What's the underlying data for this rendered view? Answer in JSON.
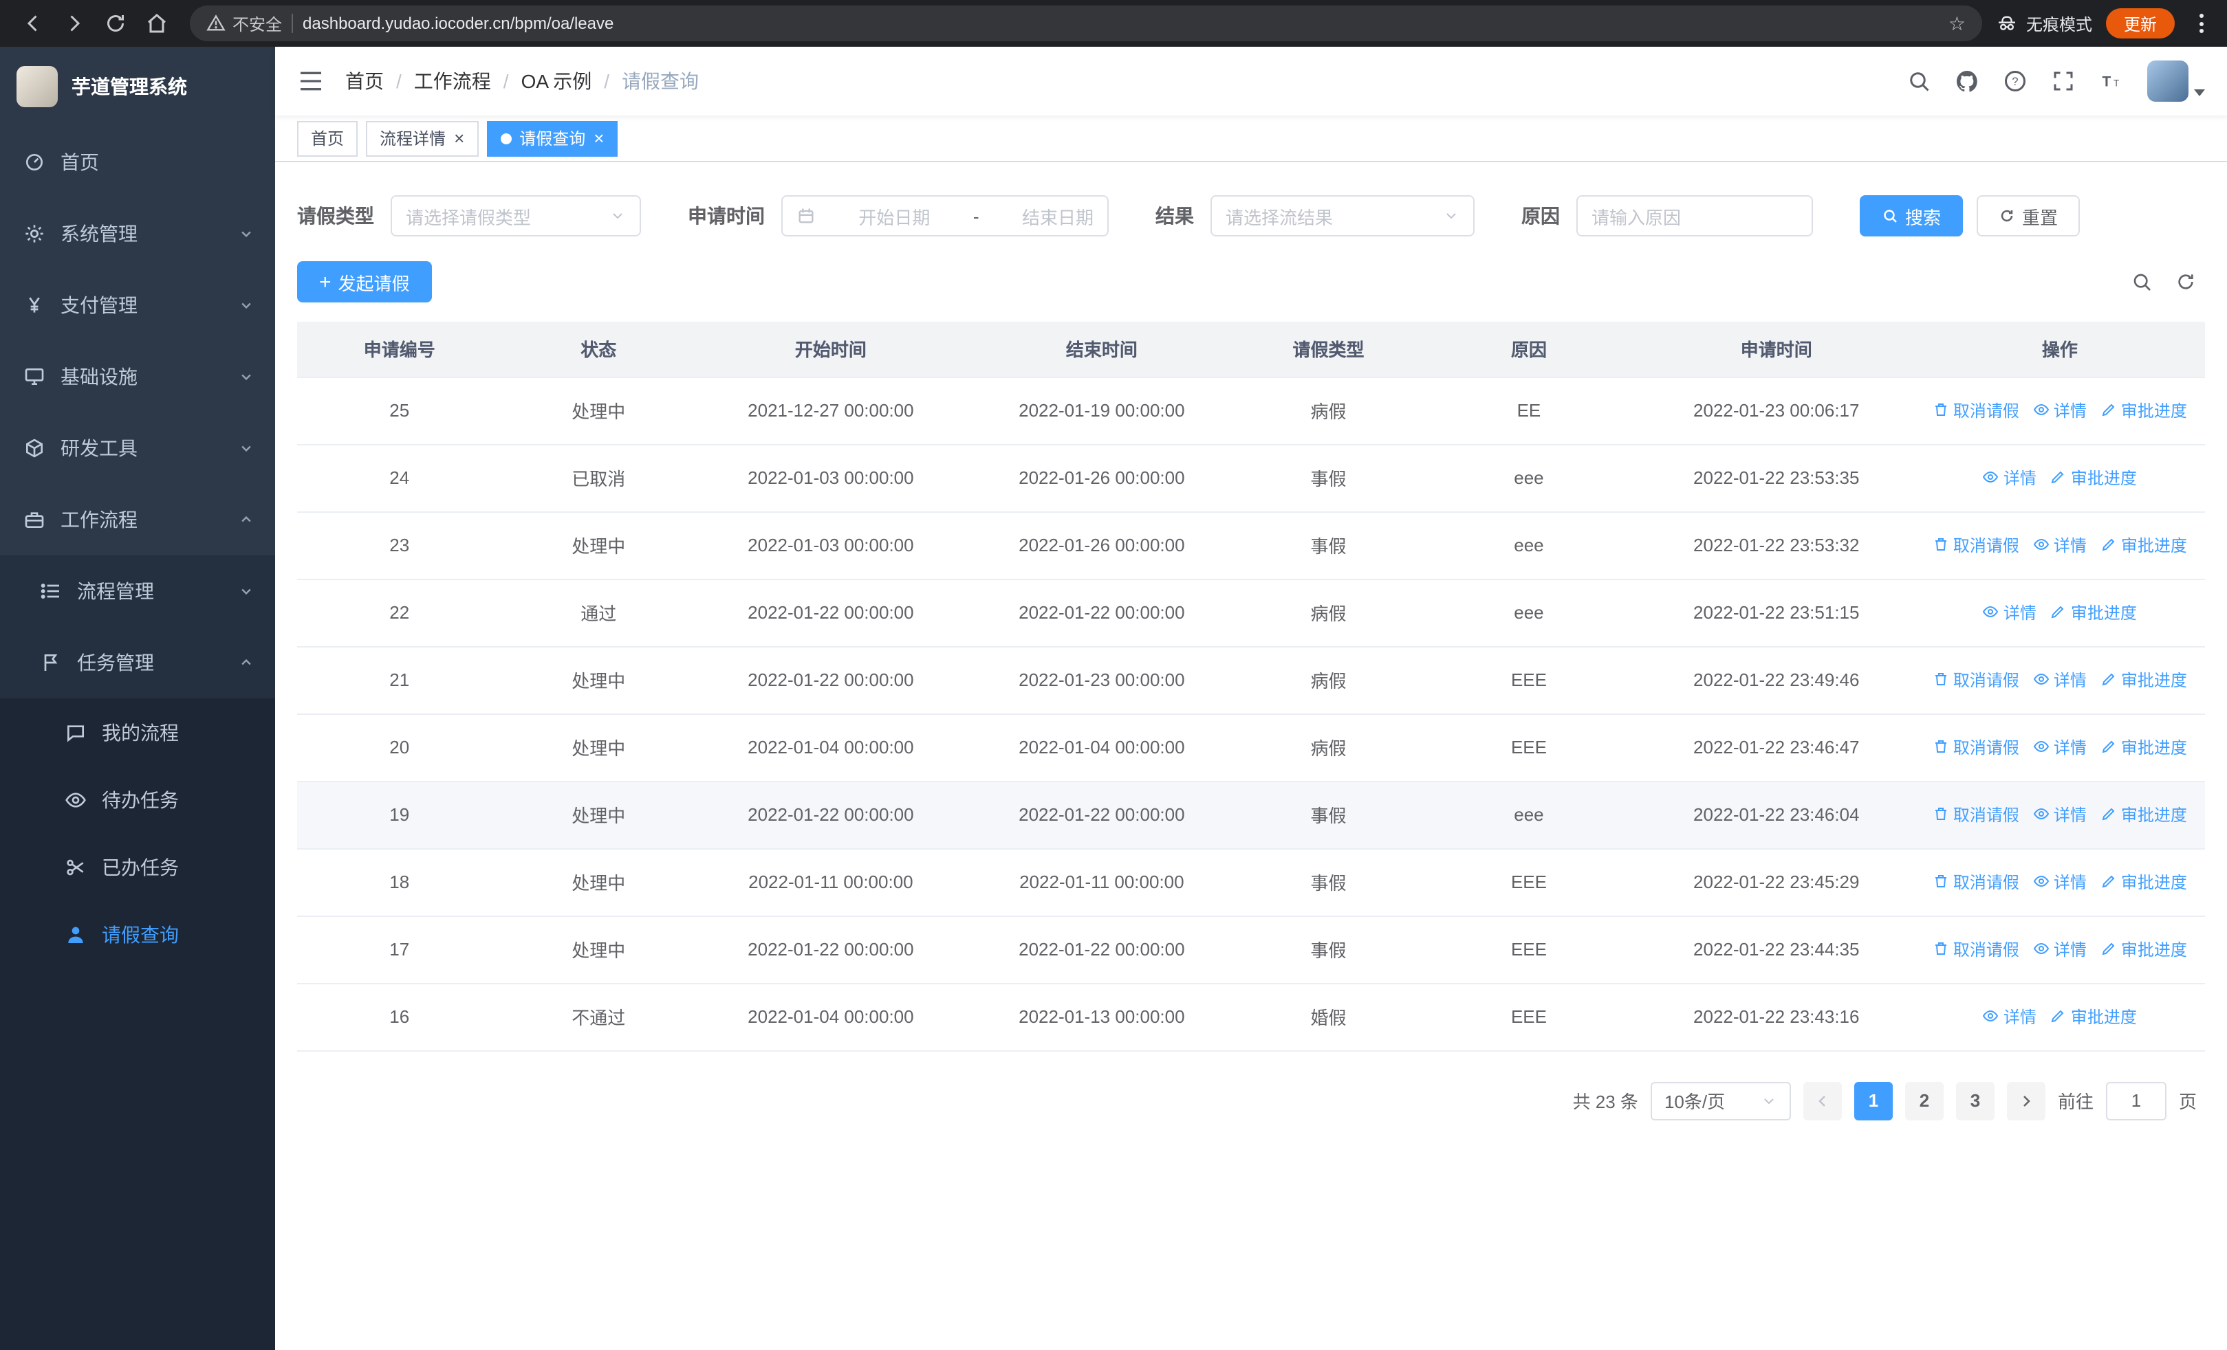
{
  "browser": {
    "security_label": "不安全",
    "url": "dashboard.yudao.iocoder.cn/bpm/oa/leave",
    "incognito_label": "无痕模式",
    "update_label": "更新"
  },
  "icons": {
    "star": "☆",
    "close": "×",
    "plus": "+",
    "breadcrumb_separator": "/"
  },
  "sidebar": {
    "title": "芋道管理系统",
    "menu": [
      {
        "label": "首页"
      },
      {
        "label": "系统管理"
      },
      {
        "label": "支付管理"
      },
      {
        "label": "基础设施"
      },
      {
        "label": "研发工具"
      },
      {
        "label": "工作流程"
      }
    ],
    "workflow_children": [
      {
        "label": "流程管理"
      },
      {
        "label": "任务管理"
      }
    ],
    "task_children": [
      {
        "label": "我的流程"
      },
      {
        "label": "待办任务"
      },
      {
        "label": "已办任务"
      },
      {
        "label": "请假查询"
      }
    ]
  },
  "header": {
    "breadcrumb": [
      "首页",
      "工作流程",
      "OA 示例",
      "请假查询"
    ]
  },
  "tabs": [
    {
      "label": "首页"
    },
    {
      "label": "流程详情"
    },
    {
      "label": "请假查询"
    }
  ],
  "filters": {
    "leave_type_label": "请假类型",
    "leave_type_placeholder": "请选择请假类型",
    "apply_time_label": "申请时间",
    "start_date_placeholder": "开始日期",
    "range_separator": "-",
    "end_date_placeholder": "结束日期",
    "result_label": "结果",
    "result_placeholder": "请选择流结果",
    "reason_label": "原因",
    "reason_placeholder": "请输入原因",
    "search_button": "搜索",
    "reset_button": "重置"
  },
  "toolbar": {
    "create_label": "发起请假"
  },
  "table": {
    "columns": [
      "申请编号",
      "状态",
      "开始时间",
      "结束时间",
      "请假类型",
      "原因",
      "申请时间",
      "操作"
    ],
    "action_labels": {
      "cancel": "取消请假",
      "detail": "详情",
      "progress": "审批进度"
    },
    "rows": [
      {
        "id": "25",
        "status": "处理中",
        "start": "2021-12-27 00:00:00",
        "end": "2022-01-19 00:00:00",
        "type": "病假",
        "reason": "EE",
        "apply_time": "2022-01-23 00:06:17",
        "actions": [
          "cancel",
          "detail",
          "progress"
        ]
      },
      {
        "id": "24",
        "status": "已取消",
        "start": "2022-01-03 00:00:00",
        "end": "2022-01-26 00:00:00",
        "type": "事假",
        "reason": "eee",
        "apply_time": "2022-01-22 23:53:35",
        "actions": [
          "detail",
          "progress"
        ]
      },
      {
        "id": "23",
        "status": "处理中",
        "start": "2022-01-03 00:00:00",
        "end": "2022-01-26 00:00:00",
        "type": "事假",
        "reason": "eee",
        "apply_time": "2022-01-22 23:53:32",
        "actions": [
          "cancel",
          "detail",
          "progress"
        ]
      },
      {
        "id": "22",
        "status": "通过",
        "start": "2022-01-22 00:00:00",
        "end": "2022-01-22 00:00:00",
        "type": "病假",
        "reason": "eee",
        "apply_time": "2022-01-22 23:51:15",
        "actions": [
          "detail",
          "progress"
        ]
      },
      {
        "id": "21",
        "status": "处理中",
        "start": "2022-01-22 00:00:00",
        "end": "2022-01-23 00:00:00",
        "type": "病假",
        "reason": "EEE",
        "apply_time": "2022-01-22 23:49:46",
        "actions": [
          "cancel",
          "detail",
          "progress"
        ]
      },
      {
        "id": "20",
        "status": "处理中",
        "start": "2022-01-04 00:00:00",
        "end": "2022-01-04 00:00:00",
        "type": "病假",
        "reason": "EEE",
        "apply_time": "2022-01-22 23:46:47",
        "actions": [
          "cancel",
          "detail",
          "progress"
        ]
      },
      {
        "id": "19",
        "status": "处理中",
        "start": "2022-01-22 00:00:00",
        "end": "2022-01-22 00:00:00",
        "type": "事假",
        "reason": "eee",
        "apply_time": "2022-01-22 23:46:04",
        "actions": [
          "cancel",
          "detail",
          "progress"
        ],
        "highlighted": true
      },
      {
        "id": "18",
        "status": "处理中",
        "start": "2022-01-11 00:00:00",
        "end": "2022-01-11 00:00:00",
        "type": "事假",
        "reason": "EEE",
        "apply_time": "2022-01-22 23:45:29",
        "actions": [
          "cancel",
          "detail",
          "progress"
        ]
      },
      {
        "id": "17",
        "status": "处理中",
        "start": "2022-01-22 00:00:00",
        "end": "2022-01-22 00:00:00",
        "type": "事假",
        "reason": "EEE",
        "apply_time": "2022-01-22 23:44:35",
        "actions": [
          "cancel",
          "detail",
          "progress"
        ]
      },
      {
        "id": "16",
        "status": "不通过",
        "start": "2022-01-04 00:00:00",
        "end": "2022-01-13 00:00:00",
        "type": "婚假",
        "reason": "EEE",
        "apply_time": "2022-01-22 23:43:16",
        "actions": [
          "detail",
          "progress"
        ]
      }
    ]
  },
  "pagination": {
    "total_label": "共 23 条",
    "page_size_label": "10条/页",
    "pages": [
      "1",
      "2",
      "3"
    ],
    "goto_prefix": "前往",
    "goto_value": "1",
    "goto_suffix": "页"
  }
}
